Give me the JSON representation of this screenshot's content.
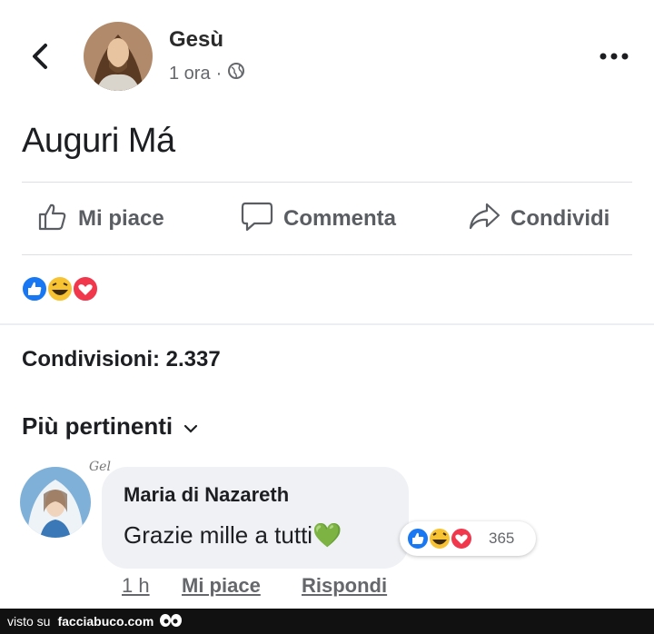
{
  "post": {
    "author": "Gesù",
    "time": "1 ora",
    "separator": "·",
    "text": "Auguri Má"
  },
  "actions": {
    "like": "Mi piace",
    "comment": "Commenta",
    "share": "Condividi"
  },
  "reactions": [
    "like",
    "haha",
    "love"
  ],
  "stats": {
    "shares": "Condivisioni: 2.337"
  },
  "filter": {
    "label": "Più pertinenti"
  },
  "comment": {
    "author": "Maria di Nazareth",
    "text": "Grazie mille a tutti",
    "emoji": "💚",
    "reaction_count": "365",
    "handwritten": "Gel",
    "time": "1 h",
    "like": "Mi piace",
    "reply": "Rispondi"
  },
  "footer": {
    "visto_su": "visto su",
    "site": "facciabuco.com"
  },
  "colors": {
    "like_blue": "#1877f2",
    "haha_yellow": "#f7c332",
    "love_red": "#f0374c",
    "heart_green": "#3cb043"
  },
  "icons": [
    "back-arrow-icon",
    "globe-icon",
    "more-icon",
    "thumbs-up-icon",
    "comment-icon",
    "share-icon",
    "chevron-down-icon"
  ]
}
